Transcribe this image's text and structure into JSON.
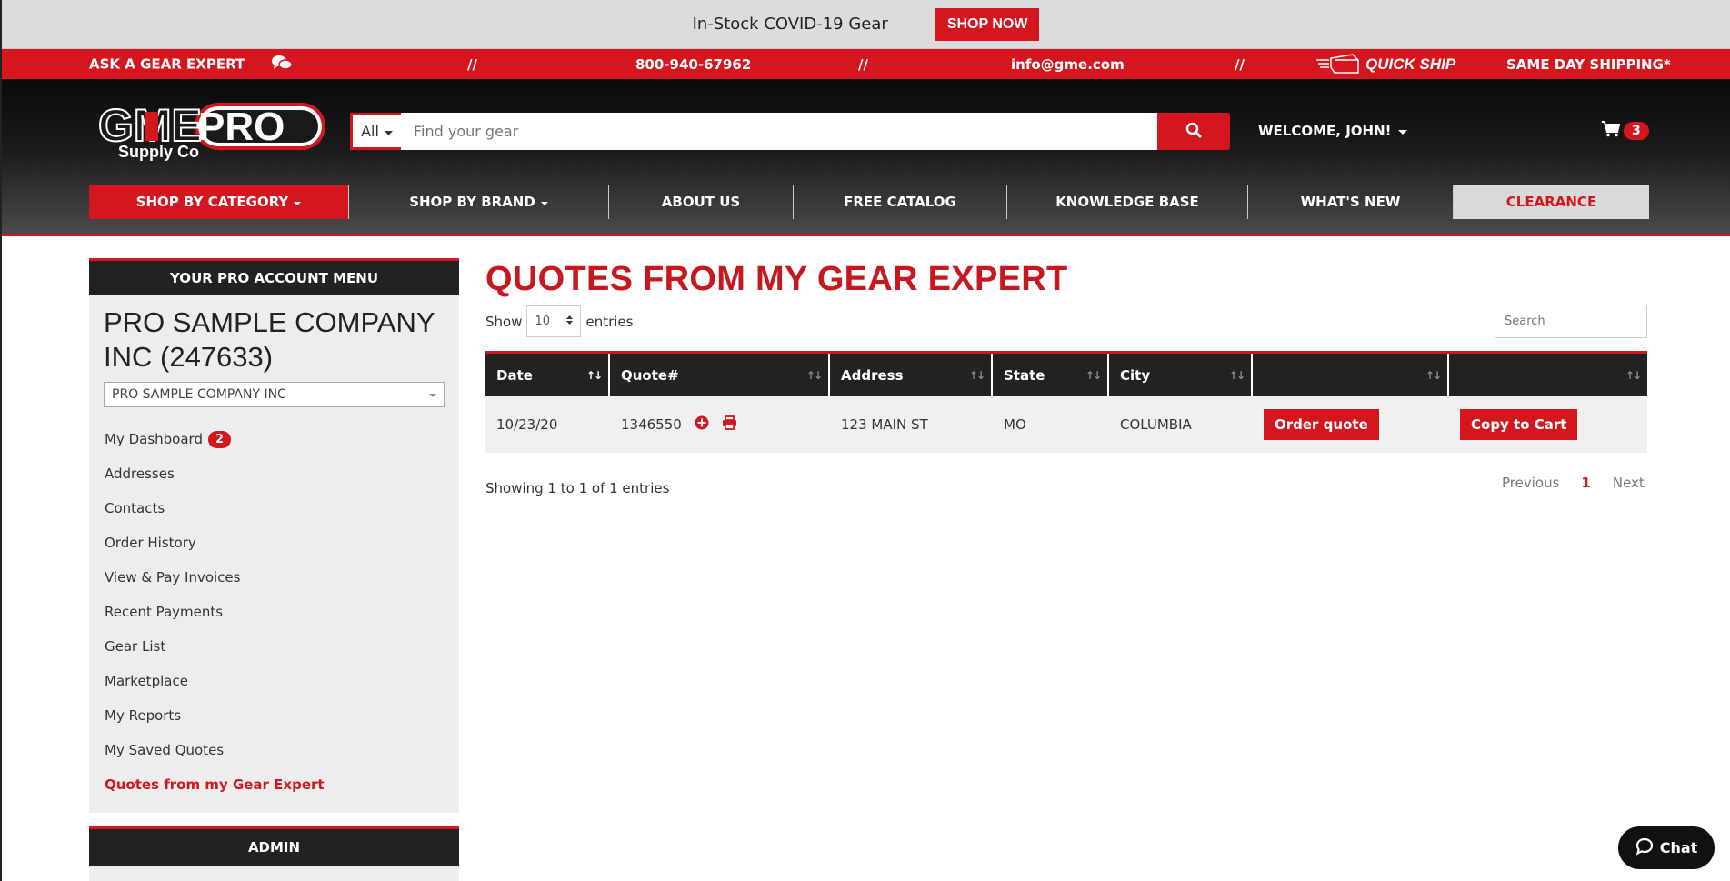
{
  "promo": {
    "text": "In-Stock COVID-19 Gear",
    "button": "SHOP NOW"
  },
  "infobar": {
    "ask_expert": "ASK A GEAR EXPERT",
    "separator": "//",
    "phone": "800-940-67962",
    "email": "info@gme.com",
    "quick_ship": "QUICK SHIP",
    "same_day": "SAME DAY SHIPPING*"
  },
  "header": {
    "logo_text_left": "GME",
    "logo_text_pro": "PRO",
    "logo_text_sub": "Supply Co",
    "search_scope": "All",
    "search_placeholder": "Find your gear",
    "welcome": "WELCOME, JOHN!",
    "cart_count": "3"
  },
  "nav": [
    {
      "label": "SHOP BY CATEGORY"
    },
    {
      "label": "SHOP BY BRAND"
    },
    {
      "label": "ABOUT US"
    },
    {
      "label": "FREE CATALOG"
    },
    {
      "label": "KNOWLEDGE BASE"
    },
    {
      "label": "WHAT'S NEW"
    },
    {
      "label": "CLEARANCE"
    }
  ],
  "sidebar": {
    "heading": "YOUR PRO ACCOUNT MENU",
    "company_line1": "PRO SAMPLE COMPANY",
    "company_line2": "INC (247633)",
    "company_select": "PRO SAMPLE COMPANY INC",
    "items": [
      {
        "label": "My Dashboard",
        "badge": "2"
      },
      {
        "label": "Addresses"
      },
      {
        "label": "Contacts"
      },
      {
        "label": "Order History"
      },
      {
        "label": "View & Pay Invoices"
      },
      {
        "label": "Recent Payments"
      },
      {
        "label": "Gear List"
      },
      {
        "label": "Marketplace"
      },
      {
        "label": "My Reports"
      },
      {
        "label": "My Saved Quotes"
      },
      {
        "label": "Quotes from my Gear Expert"
      }
    ],
    "admin_heading": "ADMIN"
  },
  "main": {
    "title": "QUOTES FROM MY GEAR EXPERT",
    "show_label": "Show",
    "page_size": "10",
    "entries_label": "entries",
    "search_placeholder": "Search",
    "columns": [
      "Date",
      "Quote#",
      "Address",
      "State",
      "City",
      "",
      ""
    ],
    "rows": [
      {
        "date": "10/23/20",
        "quote": "1346550",
        "address": "123 MAIN ST",
        "state": "MO",
        "city": "COLUMBIA",
        "order_btn": "Order quote",
        "copy_btn": "Copy to Cart"
      }
    ],
    "showing": "Showing 1 to 1 of 1 entries",
    "pager": {
      "prev": "Previous",
      "current": "1",
      "next": "Next"
    }
  },
  "chat": {
    "label": "Chat"
  },
  "colors": {
    "brand_red": "#d4171f",
    "dark": "#222222",
    "sidebar_bg": "#ededee"
  }
}
